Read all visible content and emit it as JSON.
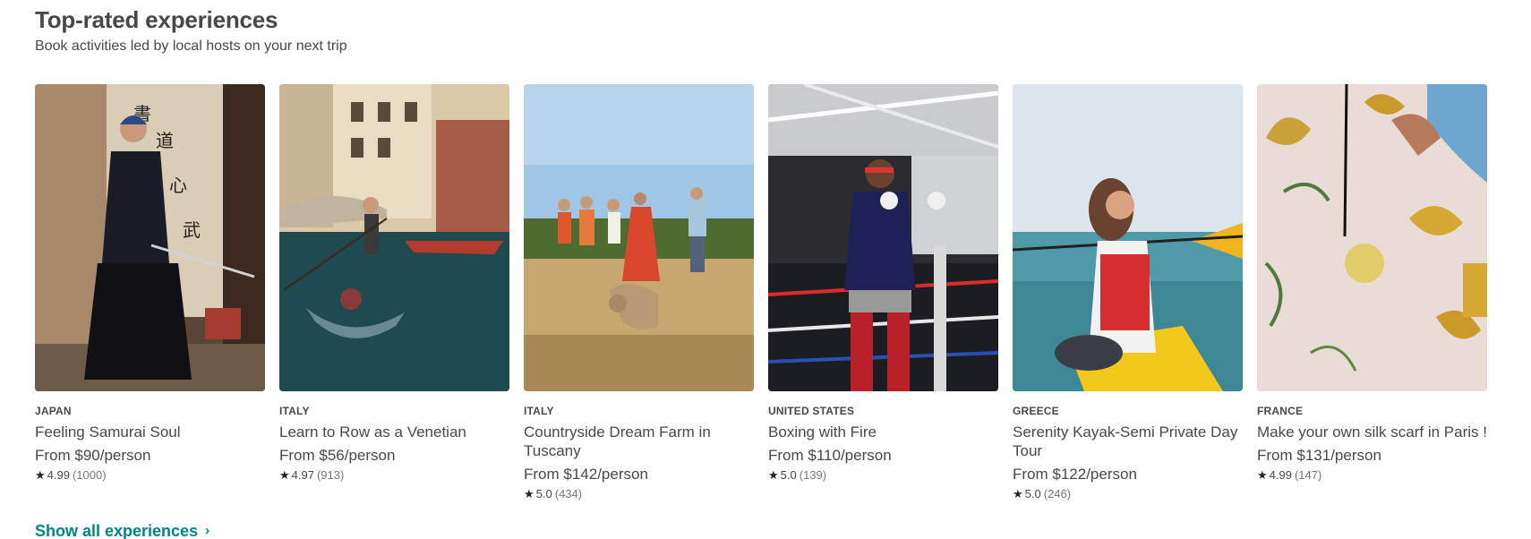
{
  "header": {
    "title": "Top-rated experiences",
    "subtitle": "Book activities led by local hosts on your next trip"
  },
  "cards": [
    {
      "country": "JAPAN",
      "title": "Feeling Samurai Soul",
      "price": "From $90/person",
      "rating": "4.99",
      "reviews": "(1000)"
    },
    {
      "country": "ITALY",
      "title": "Learn to Row as a Venetian",
      "price": "From $56/person",
      "rating": "4.97",
      "reviews": "(913)"
    },
    {
      "country": "ITALY",
      "title": "Countryside Dream Farm in Tuscany",
      "price": "From $142/person",
      "rating": "5.0",
      "reviews": "(434)"
    },
    {
      "country": "UNITED STATES",
      "title": "Boxing with Fire",
      "price": "From $110/person",
      "rating": "5.0",
      "reviews": "(139)"
    },
    {
      "country": "GREECE",
      "title": "Serenity Kayak-Semi Private Day Tour",
      "price": "From $122/person",
      "rating": "5.0",
      "reviews": "(246)"
    },
    {
      "country": "FRANCE",
      "title": "Make your own silk scarf in Paris !",
      "price": "From $131/person",
      "rating": "4.99",
      "reviews": "(147)"
    }
  ],
  "footer": {
    "show_all_label": "Show all experiences"
  },
  "icons": {
    "star": "star-icon",
    "chevron": "chevron-right-icon"
  },
  "colors": {
    "link": "#008489",
    "text": "#484848",
    "muted": "#767676"
  }
}
